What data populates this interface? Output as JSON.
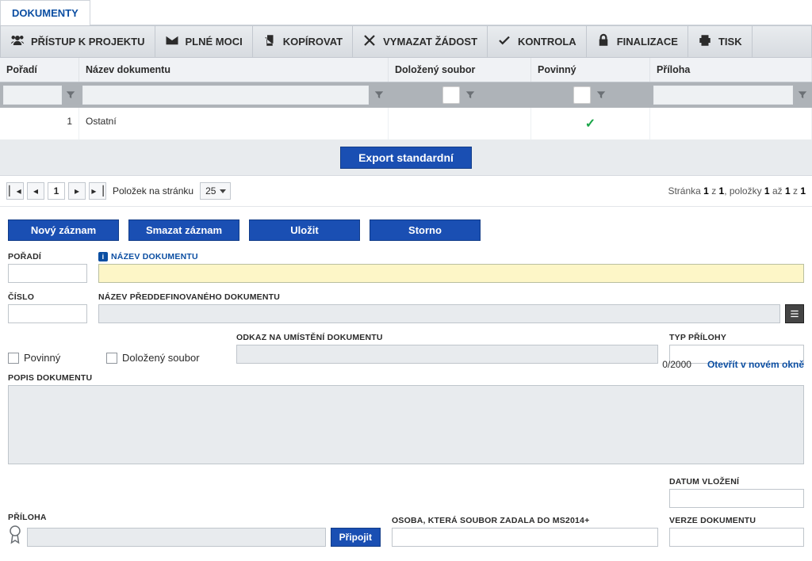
{
  "tabs": {
    "documents": "DOKUMENTY"
  },
  "toolbar": {
    "access": "PŘÍSTUP K PROJEKTU",
    "poa": "PLNÉ MOCI",
    "copy": "KOPÍROVAT",
    "delete": "VYMAZAT ŽÁDOST",
    "check": "KONTROLA",
    "finalize": "FINALIZACE",
    "print": "TISK"
  },
  "grid": {
    "headers": {
      "poradi": "Pořadí",
      "nazev": "Název dokumentu",
      "dolozeny": "Doložený soubor",
      "povinny": "Povinný",
      "priloha": "Příloha"
    },
    "rows": [
      {
        "poradi": "1",
        "nazev": "Ostatní",
        "dolozeny": "",
        "povinny_checked": true,
        "priloha": ""
      }
    ],
    "export_btn": "Export standardní"
  },
  "pager": {
    "page": "1",
    "per_page_label": "Položek na stránku",
    "per_page_value": "25",
    "summary_prefix": "Stránka ",
    "summary_page": "1",
    "summary_of": " z ",
    "summary_pages": "1",
    "summary_items_prefix": ", položky ",
    "summary_from": "1",
    "summary_to_word": " až ",
    "summary_to": "1",
    "summary_total_of": " z ",
    "summary_total": "1"
  },
  "actions": {
    "new": "Nový záznam",
    "del": "Smazat záznam",
    "save": "Uložit",
    "cancel": "Storno"
  },
  "form": {
    "poradi_label": "POŘADÍ",
    "cislo_label": "ČÍSLO",
    "nazev_label": "NÁZEV DOKUMENTU",
    "predef_label": "NÁZEV PŘEDDEFINOVANÉHO DOKUMENTU",
    "povinny_label": "Povinný",
    "dolozeny_label": "Doložený soubor",
    "odkaz_label": "ODKAZ NA UMÍSTĚNÍ DOKUMENTU",
    "typ_label": "TYP PŘÍLOHY",
    "popis_label": "POPIS DOKUMENTU",
    "popis_counter": "0/2000",
    "popis_link": "Otevřít v novém okně",
    "priloha_label": "PŘÍLOHA",
    "attach_btn": "Připojit",
    "osoba_label": "OSOBA, KTERÁ SOUBOR ZADALA DO MS2014+",
    "datum_label": "DATUM VLOŽENÍ",
    "verze_label": "VERZE DOKUMENTU"
  }
}
